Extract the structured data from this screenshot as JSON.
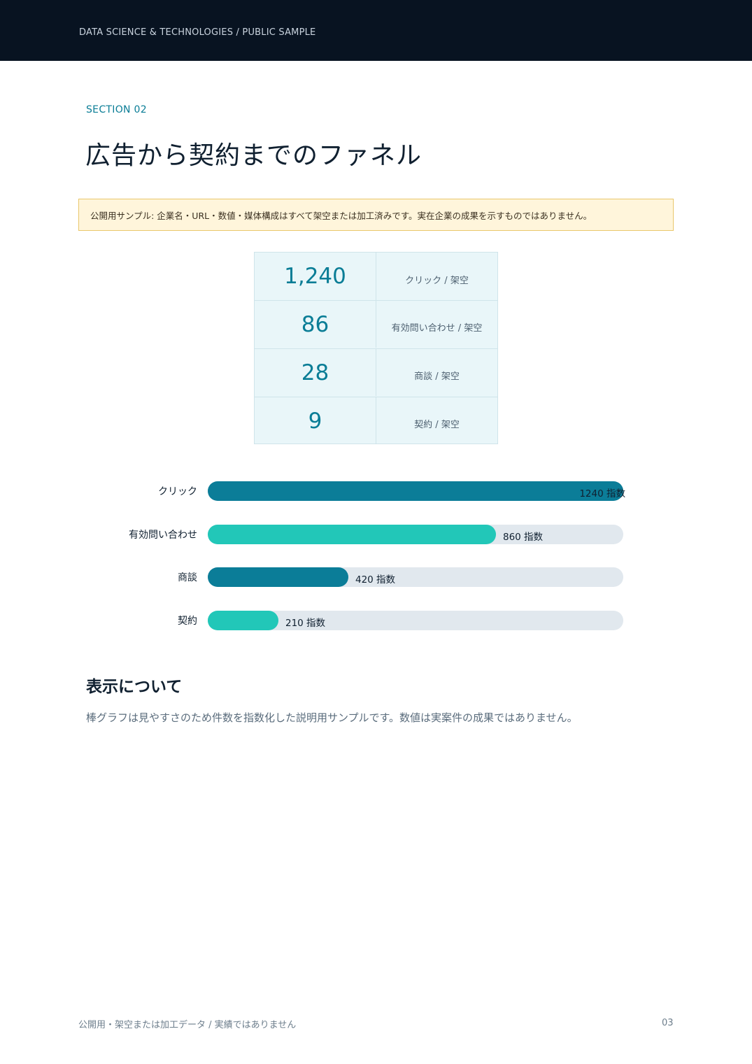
{
  "header": {
    "text": "DATA SCIENCE & TECHNOLOGIES / PUBLIC SAMPLE"
  },
  "section": {
    "label": "SECTION 02",
    "title": "広告から契約までのファネル"
  },
  "notice": {
    "text": "公開用サンプル: 企業名・URL・数値・媒体構成はすべて架空または加工済みです。実在企業の成果を示すものではありません。"
  },
  "kpis": [
    {
      "value": "1,240",
      "label": "クリック / 架空"
    },
    {
      "value": "86",
      "label": "有効問い合わせ / 架空"
    },
    {
      "value": "28",
      "label": "商談 / 架空"
    },
    {
      "value": "9",
      "label": "契約 / 架空"
    }
  ],
  "chart_data": {
    "type": "bar",
    "orientation": "horizontal",
    "categories": [
      "クリック",
      "有効問い合わせ",
      "商談",
      "契約"
    ],
    "values": [
      1240,
      860,
      420,
      210
    ],
    "value_labels": [
      "1240 指数",
      "860 指数",
      "420 指数",
      "210 指数"
    ],
    "unit": "指数",
    "xlim": [
      0,
      1240
    ],
    "colors": [
      "#0b7d98",
      "#22c7b8",
      "#0b7d98",
      "#22c7b8"
    ],
    "track_color": "#e1e8ee"
  },
  "notes": {
    "title": "表示について",
    "body": "棒グラフは見やすさのため件数を指数化した説明用サンプルです。数値は実案件の成果ではありません。"
  },
  "footer": {
    "left": "公開用・架空または加工データ / 実績ではありません",
    "page": "03"
  }
}
